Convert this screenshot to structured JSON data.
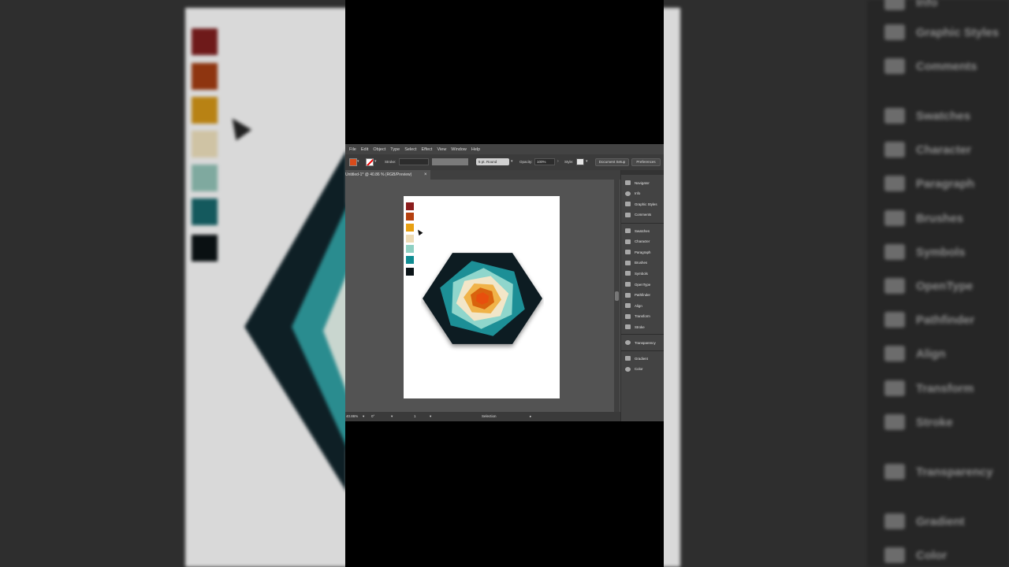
{
  "background": {
    "panel_items": [
      {
        "label": "Info",
        "icon": "info-icon"
      },
      {
        "label": "Graphic Styles",
        "icon": "graphic-styles-icon"
      },
      {
        "label": "Comments",
        "icon": "comments-icon"
      },
      {
        "label": "Swatches",
        "icon": "swatches-icon"
      },
      {
        "label": "Character",
        "icon": "character-icon"
      },
      {
        "label": "Paragraph",
        "icon": "paragraph-icon"
      },
      {
        "label": "Brushes",
        "icon": "brushes-icon"
      },
      {
        "label": "Symbols",
        "icon": "symbols-icon"
      },
      {
        "label": "OpenType",
        "icon": "opentype-icon"
      },
      {
        "label": "Pathfinder",
        "icon": "pathfinder-icon"
      },
      {
        "label": "Align",
        "icon": "align-icon"
      },
      {
        "label": "Transform",
        "icon": "transform-icon"
      },
      {
        "label": "Stroke",
        "icon": "stroke-icon"
      },
      {
        "label": "Transparency",
        "icon": "transparency-icon"
      },
      {
        "label": "Gradient",
        "icon": "gradient-icon"
      },
      {
        "label": "Color",
        "icon": "color-icon"
      }
    ]
  },
  "menu": [
    "File",
    "Edit",
    "Object",
    "Type",
    "Select",
    "Effect",
    "View",
    "Window",
    "Help"
  ],
  "control_bar": {
    "stroke_label": "Stroke:",
    "brush_value": "5 pt. Round",
    "opacity_label": "Opacity:",
    "opacity_value": "100%",
    "style_label": "Style:",
    "document_setup": "Document Setup",
    "preferences": "Preferences"
  },
  "document_tab": {
    "title": "Untitled-1* @ 40.86 % (RGB/Preview)",
    "close": "×"
  },
  "swatches": [
    "#8b1d1d",
    "#b5400f",
    "#e8a013",
    "#eddbb5",
    "#8fd0c3",
    "#0f8c92",
    "#0b1418"
  ],
  "hexagon_layers": [
    "#0b1a20",
    "#1f8f96",
    "#8fd6cc",
    "#f2e6c8",
    "#f0b34a",
    "#d9640f",
    "#e8500c"
  ],
  "status_bar": {
    "zoom": "40.86%",
    "rotation": "0°",
    "artboard_number": "1",
    "tool": "Selection"
  },
  "panels": {
    "group1": [
      {
        "label": "Navigator",
        "icon": "navigator-icon"
      },
      {
        "label": "Info",
        "icon": "info-icon"
      },
      {
        "label": "Graphic Styles",
        "icon": "graphic-styles-icon"
      },
      {
        "label": "Comments",
        "icon": "comments-icon"
      }
    ],
    "group2": [
      {
        "label": "Swatches",
        "icon": "swatches-icon"
      },
      {
        "label": "Character",
        "icon": "character-icon"
      },
      {
        "label": "Paragraph",
        "icon": "paragraph-icon"
      },
      {
        "label": "Brushes",
        "icon": "brushes-icon"
      },
      {
        "label": "Symbols",
        "icon": "symbols-icon"
      },
      {
        "label": "OpenType",
        "icon": "opentype-icon"
      },
      {
        "label": "Pathfinder",
        "icon": "pathfinder-icon"
      },
      {
        "label": "Align",
        "icon": "align-icon"
      },
      {
        "label": "Transform",
        "icon": "transform-icon"
      },
      {
        "label": "Stroke",
        "icon": "stroke-icon"
      }
    ],
    "group3": [
      {
        "label": "Transparency",
        "icon": "transparency-icon"
      }
    ],
    "group4": [
      {
        "label": "Gradient",
        "icon": "gradient-icon"
      },
      {
        "label": "Color",
        "icon": "color-icon"
      }
    ]
  }
}
